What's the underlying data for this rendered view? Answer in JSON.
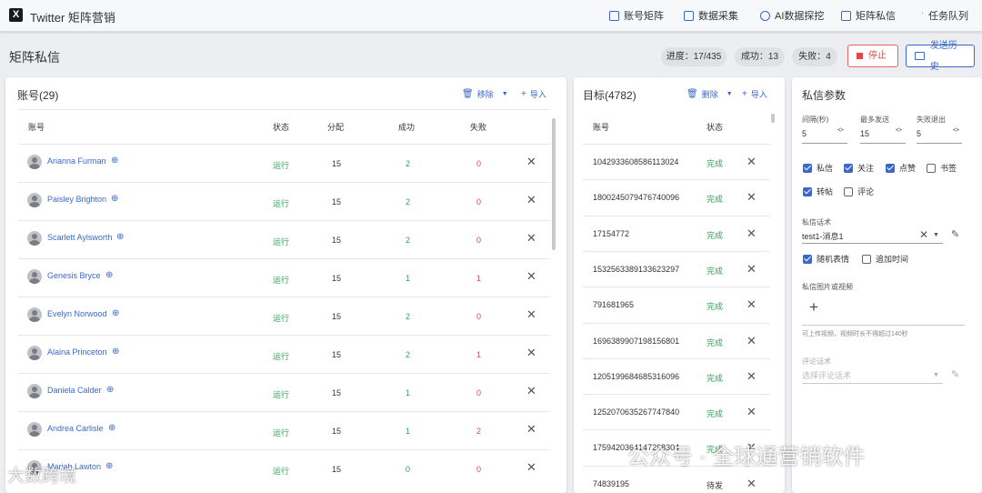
{
  "app": {
    "logo": "X",
    "title": "Twitter 矩阵营销"
  },
  "nav": [
    {
      "label": "账号矩阵",
      "icon": "account-matrix-icon"
    },
    {
      "label": "数据采集",
      "icon": "data-collect-icon"
    },
    {
      "label": "AI数据探挖",
      "icon": "ai-mining-icon"
    },
    {
      "label": "矩阵私信",
      "icon": "chat-icon"
    },
    {
      "label": "任务队列",
      "icon": "queue-icon"
    }
  ],
  "page": {
    "title": "矩阵私信"
  },
  "status": {
    "progress": "进度：17/435",
    "success": "成功：13",
    "fail": "失败：4"
  },
  "actions": {
    "stop": "停止",
    "history": "发送历史"
  },
  "accounts": {
    "title": "账号(29)",
    "remove": "移除",
    "import": "导入",
    "headers": {
      "account": "账号",
      "status": "状态",
      "assign": "分配",
      "success": "成功",
      "fail": "失败"
    },
    "rows": [
      {
        "name": "Arianna Furman",
        "status": "运行",
        "assign": "15",
        "success": "2",
        "fail": "0"
      },
      {
        "name": "Paisley Brighton",
        "status": "运行",
        "assign": "15",
        "success": "2",
        "fail": "0"
      },
      {
        "name": "Scarlett Aylsworth",
        "status": "运行",
        "assign": "15",
        "success": "2",
        "fail": "0"
      },
      {
        "name": "Genesis Bryce",
        "status": "运行",
        "assign": "15",
        "success": "1",
        "fail": "1"
      },
      {
        "name": "Evelyn Norwood",
        "status": "运行",
        "assign": "15",
        "success": "2",
        "fail": "0"
      },
      {
        "name": "Alaina Princeton",
        "status": "运行",
        "assign": "15",
        "success": "2",
        "fail": "1"
      },
      {
        "name": "Daniela Calder",
        "status": "运行",
        "assign": "15",
        "success": "1",
        "fail": "0"
      },
      {
        "name": "Andrea Carlisle",
        "status": "运行",
        "assign": "15",
        "success": "1",
        "fail": "2"
      },
      {
        "name": "Mariah Lawton",
        "status": "运行",
        "assign": "15",
        "success": "0",
        "fail": "0"
      }
    ]
  },
  "targets": {
    "title": "目标(4782)",
    "delete": "删除",
    "import": "导入",
    "headers": {
      "account": "账号",
      "status": "状态"
    },
    "rows": [
      {
        "id": "1042933608586113024",
        "status": "完成"
      },
      {
        "id": "1800245079476740096",
        "status": "完成"
      },
      {
        "id": "17154772",
        "status": "完成"
      },
      {
        "id": "1532563389133623297",
        "status": "完成"
      },
      {
        "id": "791681965",
        "status": "完成"
      },
      {
        "id": "1696389907198156801",
        "status": "完成"
      },
      {
        "id": "1205199684685316096",
        "status": "完成"
      },
      {
        "id": "1252070635267747840",
        "status": "完成"
      },
      {
        "id": "1759420364147298304",
        "status": "完成"
      },
      {
        "id": "74839195",
        "status": "待发"
      }
    ]
  },
  "params": {
    "title": "私信参数",
    "interval_label": "间隔(秒)",
    "interval": "5",
    "max_label": "最多发送",
    "max": "15",
    "fail_label": "失败退出",
    "fail": "5",
    "checks": [
      {
        "label": "私信",
        "on": true
      },
      {
        "label": "关注",
        "on": true
      },
      {
        "label": "点赞",
        "on": true
      },
      {
        "label": "书签",
        "on": false
      },
      {
        "label": "转帖",
        "on": true
      },
      {
        "label": "评论",
        "on": false
      }
    ],
    "script_label": "私信话术",
    "script_value": "test1-消息1",
    "random_emoji": "随机表情",
    "add_time": "追加时间",
    "media_label": "私信图片或视频",
    "media_add": "+",
    "media_hint": "可上传视频，视频时长不得超过140秒",
    "comment_label": "评论话术",
    "comment_placeholder": "选择评论话术"
  },
  "watermarks": {
    "left": "大数跨境",
    "right": "公众号 · 全球通营销软件"
  }
}
